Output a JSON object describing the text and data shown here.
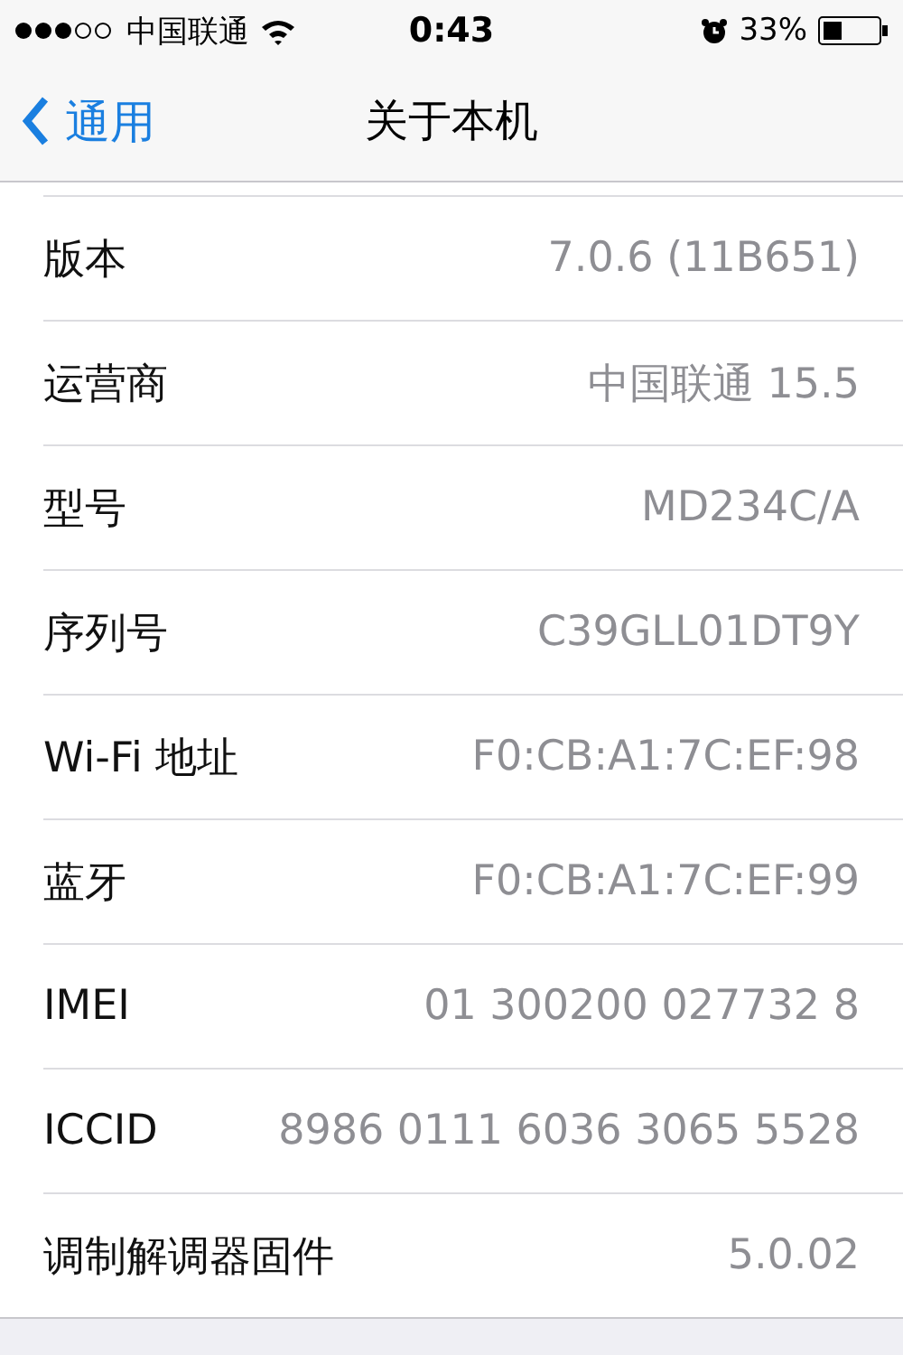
{
  "status_bar": {
    "carrier": "中国联通",
    "time": "0:43",
    "battery": "33%"
  },
  "nav": {
    "back": "通用",
    "title": "关于本机"
  },
  "rows": [
    {
      "label": "版本",
      "value": "7.0.6 (11B651)"
    },
    {
      "label": "运营商",
      "value": "中国联通 15.5"
    },
    {
      "label": "型号",
      "value": "MD234C/A"
    },
    {
      "label": "序列号",
      "value": "C39GLL01DT9Y"
    },
    {
      "label": "Wi-Fi 地址",
      "value": "F0:CB:A1:7C:EF:98"
    },
    {
      "label": "蓝牙",
      "value": "F0:CB:A1:7C:EF:99"
    },
    {
      "label": "IMEI",
      "value": "01 300200 027732 8"
    },
    {
      "label": "ICCID",
      "value": "8986 0111 6036 3065 5528"
    },
    {
      "label": "调制解调器固件",
      "value": "5.0.02"
    }
  ]
}
